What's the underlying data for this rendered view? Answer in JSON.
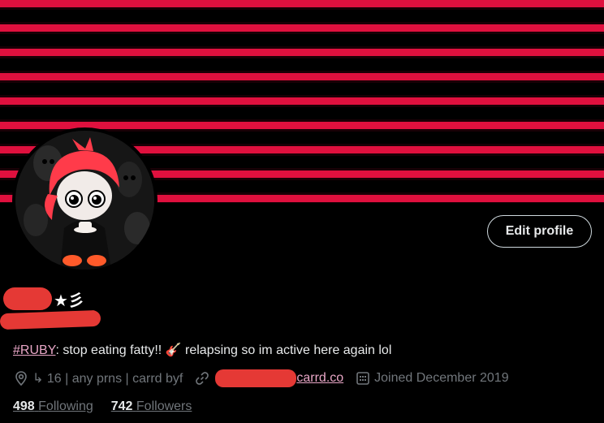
{
  "profile": {
    "name_suffix": "★彡",
    "edit_label": "Edit profile",
    "bio": {
      "hashtag": "#RUBY",
      "text": ": stop eating fatty!! 🎸 relapsing so im active here again lol"
    },
    "meta": {
      "location": "↳ 16 | any prns | carrd byf",
      "link_visible": "carrd.co",
      "joined": "Joined December 2019"
    },
    "stats": {
      "following_count": "498",
      "following_label": "Following",
      "followers_count": "742",
      "followers_label": "Followers"
    },
    "icons": [
      "location-pin-icon",
      "link-icon",
      "calendar-icon"
    ],
    "colors": {
      "banner_red": "#e0103e",
      "link_pink": "#e8a6c6",
      "redaction": "#e53935",
      "muted": "#71767b"
    }
  }
}
